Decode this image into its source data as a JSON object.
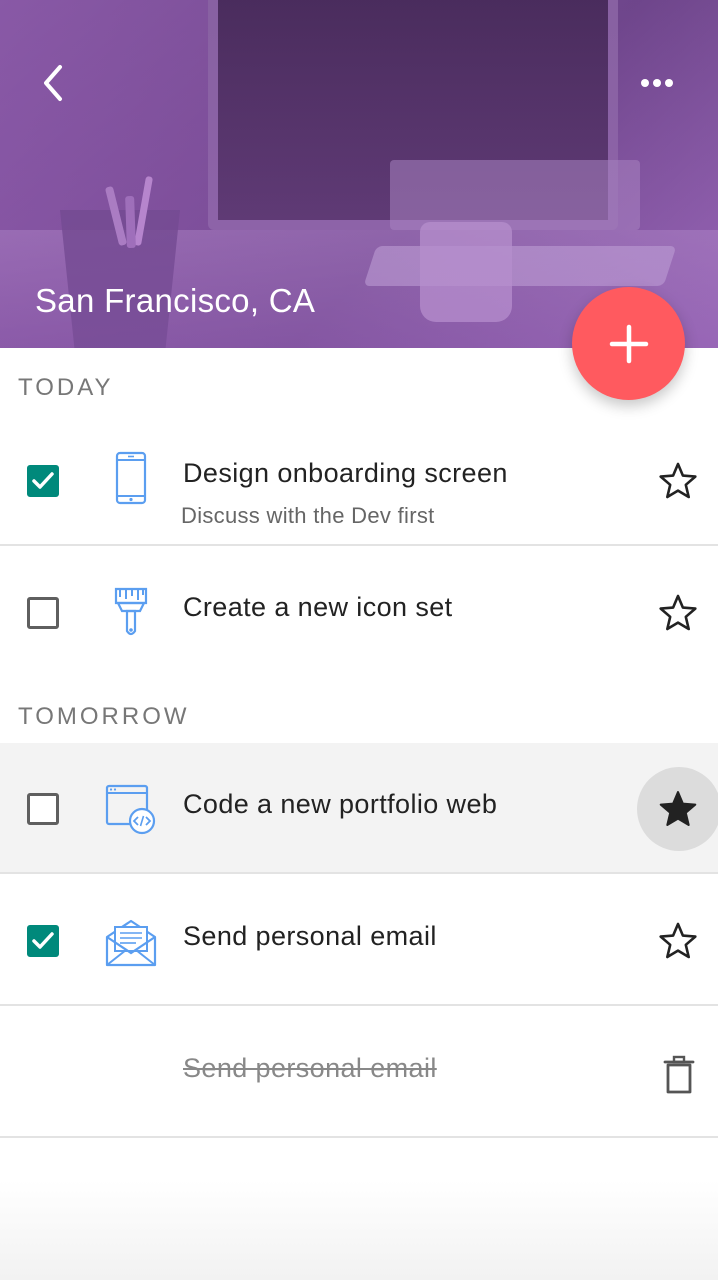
{
  "header": {
    "location": "San Francisco, CA",
    "back_icon": "chevron-left-icon",
    "more_icon": "more-horizontal-icon"
  },
  "fab": {
    "icon": "plus-icon",
    "color": "#ff5a5f"
  },
  "sections": {
    "today": "TODAY",
    "tomorrow": "TOMORROW"
  },
  "tasks": [
    {
      "title": "Design onboarding screen",
      "subtitle": "Discuss with the Dev first",
      "checked": true,
      "starred": false,
      "icon": "phone-icon"
    },
    {
      "title": "Create a new icon set",
      "checked": false,
      "starred": false,
      "icon": "paint-brush-icon"
    },
    {
      "title": "Code a new portfolio web",
      "checked": false,
      "starred": true,
      "icon": "code-window-icon"
    },
    {
      "title": "Send personal email",
      "checked": true,
      "starred": false,
      "icon": "envelope-icon"
    },
    {
      "title": "Send personal email",
      "deleted": true,
      "icon": "trash-icon"
    }
  ],
  "colors": {
    "accent": "#00897b",
    "fab": "#ff5a5f",
    "icon_blue": "#5b9ef0"
  }
}
